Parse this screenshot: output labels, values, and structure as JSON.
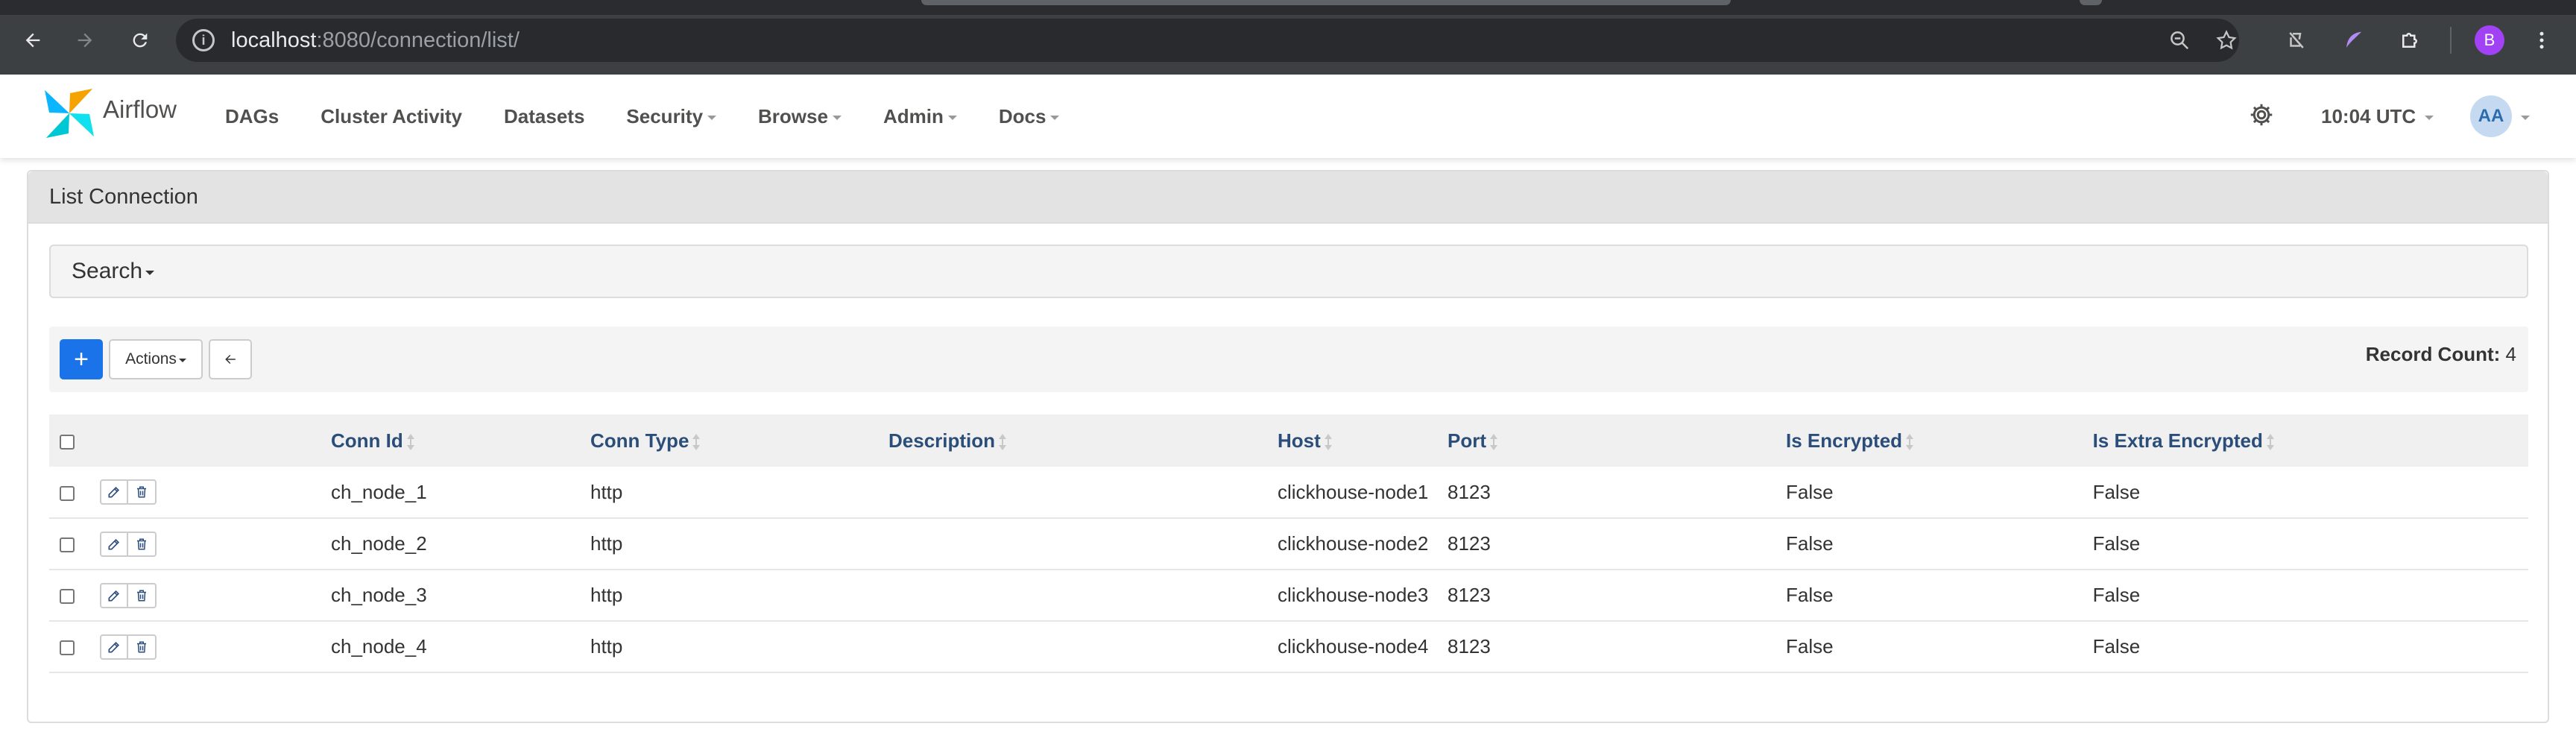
{
  "browser": {
    "url_host": "localhost",
    "url_path": ":8080/connection/list/",
    "profile_initial": "B"
  },
  "navbar": {
    "brand": "Airflow",
    "items": [
      {
        "label": "DAGs",
        "dropdown": false
      },
      {
        "label": "Cluster Activity",
        "dropdown": false
      },
      {
        "label": "Datasets",
        "dropdown": false
      },
      {
        "label": "Security",
        "dropdown": true
      },
      {
        "label": "Browse",
        "dropdown": true
      },
      {
        "label": "Admin",
        "dropdown": true
      },
      {
        "label": "Docs",
        "dropdown": true
      }
    ],
    "clock": "10:04 UTC",
    "user_initials": "AA"
  },
  "panel": {
    "title": "List Connection",
    "search_label": "Search",
    "actions_label": "Actions",
    "add_label": "+",
    "record_count_label": "Record Count:",
    "record_count": "4"
  },
  "table": {
    "columns": [
      "Conn Id",
      "Conn Type",
      "Description",
      "Host",
      "Port",
      "Is Encrypted",
      "Is Extra Encrypted"
    ],
    "rows": [
      {
        "conn_id": "ch_node_1",
        "conn_type": "http",
        "description": "",
        "host": "clickhouse-node1",
        "port": "8123",
        "is_encrypted": "False",
        "is_extra_encrypted": "False"
      },
      {
        "conn_id": "ch_node_2",
        "conn_type": "http",
        "description": "",
        "host": "clickhouse-node2",
        "port": "8123",
        "is_encrypted": "False",
        "is_extra_encrypted": "False"
      },
      {
        "conn_id": "ch_node_3",
        "conn_type": "http",
        "description": "",
        "host": "clickhouse-node3",
        "port": "8123",
        "is_encrypted": "False",
        "is_extra_encrypted": "False"
      },
      {
        "conn_id": "ch_node_4",
        "conn_type": "http",
        "description": "",
        "host": "clickhouse-node4",
        "port": "8123",
        "is_encrypted": "False",
        "is_extra_encrypted": "False"
      }
    ]
  },
  "colors": {
    "chrome_bg": "#3c4043",
    "primary_button": "#1a73e8",
    "header_link": "#2b4d7a"
  }
}
